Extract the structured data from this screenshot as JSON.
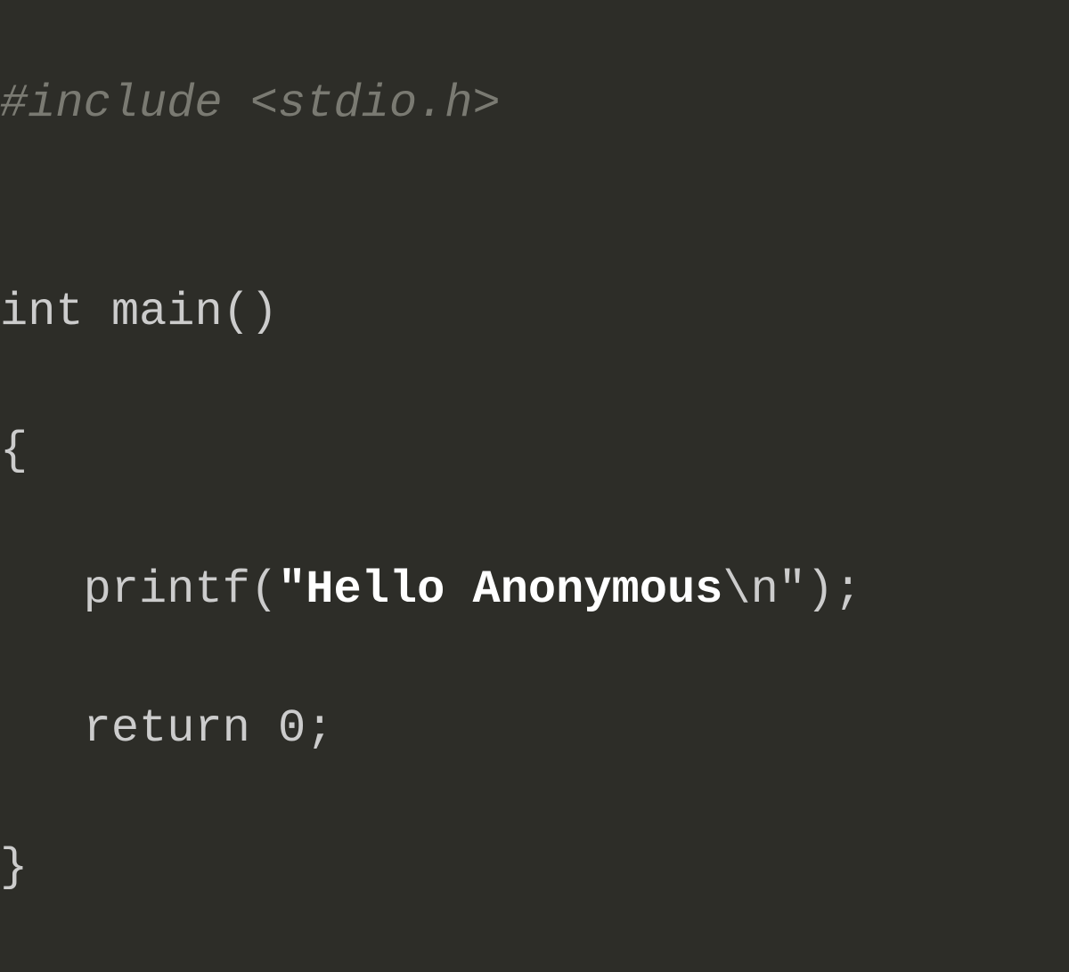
{
  "code": {
    "line1": {
      "include": "#include <stdio.h>"
    },
    "line2": "",
    "line3": {
      "type": "int",
      "func": " main()"
    },
    "line4": "{",
    "line5": {
      "indent": "   ",
      "printf_open": "printf(",
      "string_quote_open": "\"",
      "string_content": "Hello Anonymous",
      "string_newline": "\\n",
      "string_quote_close": "\"",
      "printf_close": ");"
    },
    "line6": {
      "indent": "   ",
      "return_stmt": "return 0;"
    },
    "line7": "}"
  },
  "colors": {
    "background": "#2d2d28",
    "text_default": "#cccccc",
    "text_muted": "#7a7a72",
    "text_bold": "#ffffff"
  }
}
